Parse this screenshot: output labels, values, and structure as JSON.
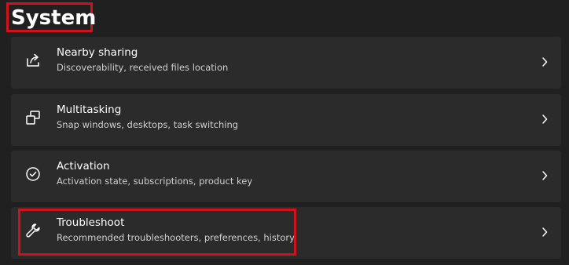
{
  "page": {
    "title": "System"
  },
  "items": [
    {
      "label": "Nearby sharing",
      "description": "Discoverability, received files location",
      "icon": "share-icon"
    },
    {
      "label": "Multitasking",
      "description": "Snap windows, desktops, task switching",
      "icon": "multitasking-icon"
    },
    {
      "label": "Activation",
      "description": "Activation state, subscriptions, product key",
      "icon": "check-circle-icon"
    },
    {
      "label": "Troubleshoot",
      "description": "Recommended troubleshooters, preferences, history",
      "icon": "wrench-icon"
    }
  ],
  "colors": {
    "background": "#202020",
    "card": "#2b2b2b",
    "highlight": "#d0121a"
  }
}
